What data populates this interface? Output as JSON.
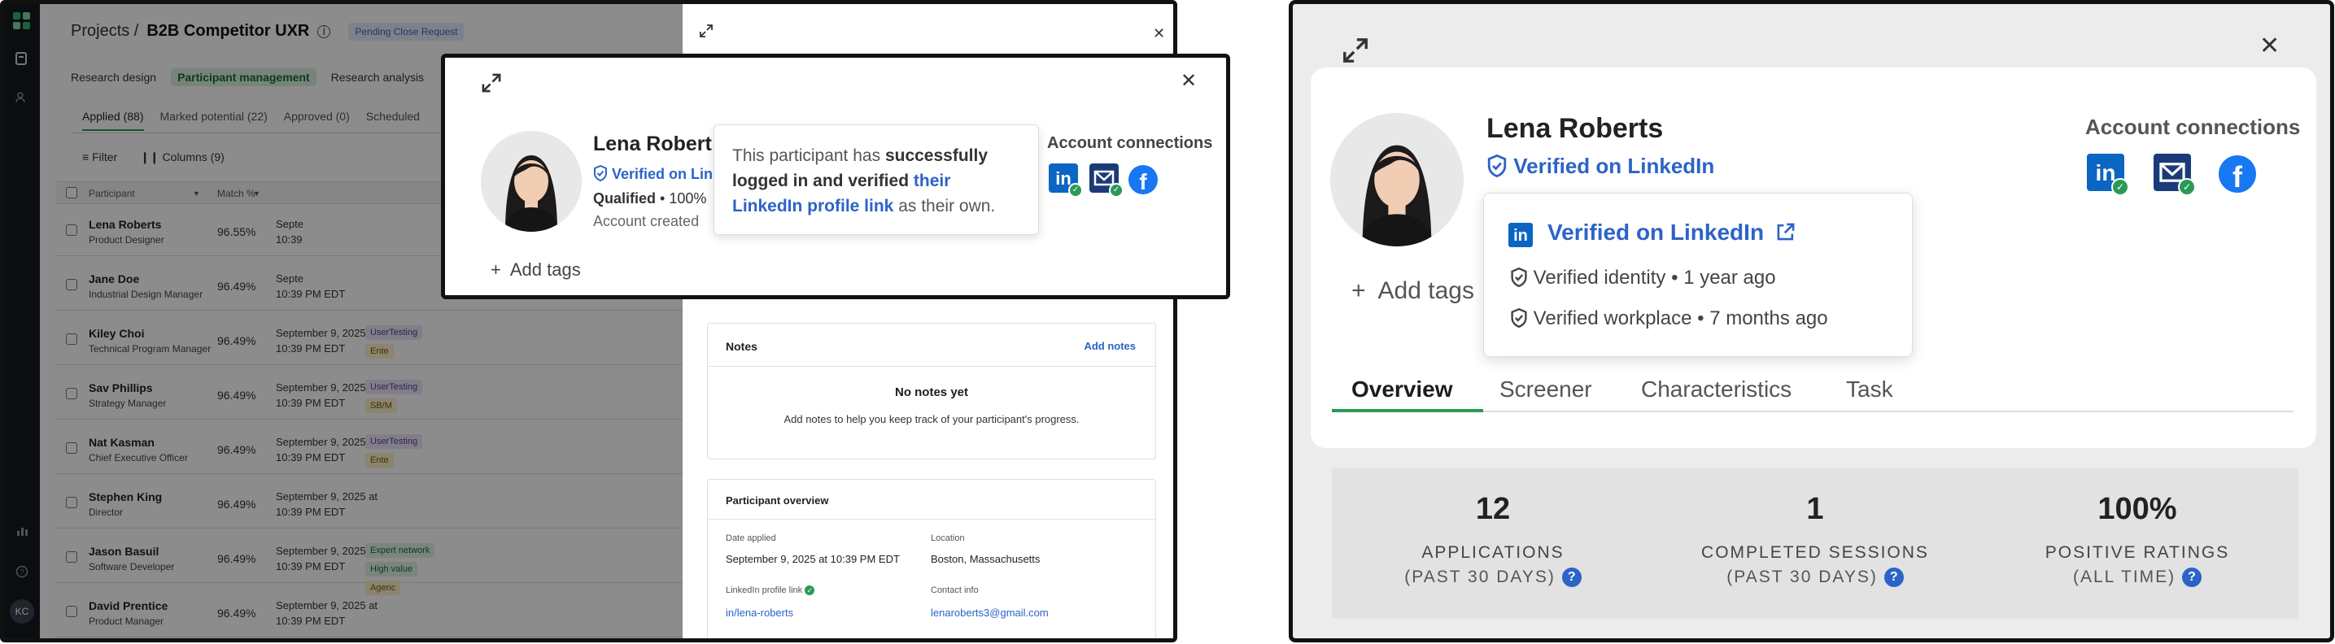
{
  "left": {
    "breadcrumb": {
      "projects": "Projects /",
      "title": "B2B Competitor UXR",
      "status": "Pending Close Request"
    },
    "section_tabs": [
      "Research design",
      "Participant management",
      "Research analysis"
    ],
    "status_tabs": [
      "Applied (88)",
      "Marked potential (22)",
      "Approved (0)",
      "Scheduled"
    ],
    "toolbar": {
      "filter": "Filter",
      "columns": "Columns (9)"
    },
    "table_headers": {
      "participant": "Participant",
      "match": "Match %"
    },
    "rail": {
      "avatar": "KC"
    },
    "rows": [
      {
        "name": "Lena Roberts",
        "role": "Product Designer",
        "match": "96.55%",
        "d1": "Septe",
        "d2": "10:39",
        "tags": []
      },
      {
        "name": "Jane Doe",
        "role": "Industrial Design Manager",
        "match": "96.49%",
        "d1": "Septe",
        "d2": "10:39 PM EDT",
        "tags": []
      },
      {
        "name": "Kiley Choi",
        "role": "Technical Program Manager",
        "match": "96.49%",
        "d1": "September 9, 2025 at",
        "d2": "10:39 PM EDT",
        "tags": [
          "UserTesting",
          "Ente"
        ]
      },
      {
        "name": "Sav Phillips",
        "role": "Strategy Manager",
        "match": "96.49%",
        "d1": "September 9, 2025 at",
        "d2": "10:39 PM EDT",
        "tags": [
          "UserTesting",
          "SB/M"
        ]
      },
      {
        "name": "Nat Kasman",
        "role": "Chief Executive Officer",
        "match": "96.49%",
        "d1": "September 9, 2025 at",
        "d2": "10:39 PM EDT",
        "tags": [
          "UserTesting",
          "Ente"
        ]
      },
      {
        "name": "Stephen King",
        "role": "Director",
        "match": "96.49%",
        "d1": "September 9, 2025 at",
        "d2": "10:39 PM EDT",
        "tags": []
      },
      {
        "name": "Jason Basuil",
        "role": "Software Developer",
        "match": "96.49%",
        "d1": "September 9, 2025 at",
        "d2": "10:39 PM EDT",
        "tags": [
          "Expert network",
          "High value",
          "Agenc"
        ]
      },
      {
        "name": "David Prentice",
        "role": "Product Manager",
        "match": "96.49%",
        "d1": "September 9, 2025 at",
        "d2": "10:39 PM EDT",
        "tags": []
      }
    ],
    "drawer": {
      "notes_title": "Notes",
      "add_notes": "Add notes",
      "no_notes": "No notes yet",
      "notes_hint": "Add notes to help you keep track of your participant's progress.",
      "overview_title": "Participant overview",
      "date_applied_label": "Date applied",
      "date_applied_value": "September 9, 2025 at 10:39 PM EDT",
      "location_label": "Location",
      "location_value": "Boston, Massachusetts",
      "linkedin_label": "LinkedIn profile link",
      "linkedin_value": "in/lena-roberts",
      "contact_label": "Contact info",
      "contact_value": "lenaroberts3@gmail.com"
    },
    "popup": {
      "name": "Lena Robert",
      "verified": "Verified on Lin",
      "qualified": "Qualified",
      "qualified_rest": " • 100%",
      "account": "Account created",
      "add_tags": "Add tags",
      "account_connections": "Account connections",
      "tooltip": {
        "p1": "This participant has ",
        "b1": "successfully logged in and verified",
        "sp": " ",
        "link": "their LinkedIn profile link",
        "p2": " as their own."
      }
    }
  },
  "right": {
    "name": "Lena Roberts",
    "verified": "Verified on LinkedIn",
    "account_connections": "Account connections",
    "add_tags": "Add tags",
    "popover": {
      "title": "Verified on LinkedIn",
      "identity": "Verified identity",
      "identity_when": "1 year ago",
      "workplace": "Verified workplace",
      "workplace_when": "7 months ago"
    },
    "tabs": [
      "Overview",
      "Screener",
      "Characteristics",
      "Task"
    ],
    "stats": [
      {
        "value": "12",
        "label": "APPLICATIONS",
        "sub": "(PAST 30 DAYS)"
      },
      {
        "value": "1",
        "label": "COMPLETED SESSIONS",
        "sub": "(PAST 30 DAYS)"
      },
      {
        "value": "100%",
        "label": "POSITIVE RATINGS",
        "sub": "(ALL TIME)"
      }
    ]
  },
  "colors": {
    "accent_green": "#2a9a56",
    "link_blue": "#2c63c7",
    "linkedin": "#0a66c2",
    "facebook": "#1877f2"
  },
  "icons": [
    "expand-icon",
    "close-icon",
    "shield-check-icon",
    "plus-icon",
    "linkedin-icon",
    "mail-icon",
    "facebook-icon",
    "external-link-icon",
    "question-icon",
    "filter-icon",
    "columns-icon",
    "info-icon"
  ]
}
